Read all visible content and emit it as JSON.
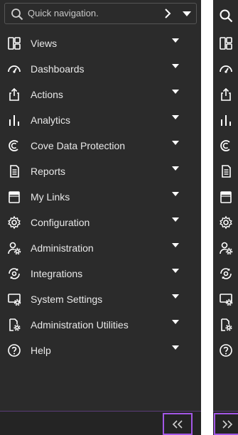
{
  "search": {
    "placeholder": "Quick navigation."
  },
  "nav": {
    "items": [
      {
        "label": "Views",
        "icon": "views-icon"
      },
      {
        "label": "Dashboards",
        "icon": "dashboards-icon"
      },
      {
        "label": "Actions",
        "icon": "actions-icon"
      },
      {
        "label": "Analytics",
        "icon": "analytics-icon"
      },
      {
        "label": "Cove Data Protection",
        "icon": "cove-icon"
      },
      {
        "label": "Reports",
        "icon": "reports-icon"
      },
      {
        "label": "My Links",
        "icon": "links-icon"
      },
      {
        "label": "Configuration",
        "icon": "configuration-icon"
      },
      {
        "label": "Administration",
        "icon": "administration-icon"
      },
      {
        "label": "Integrations",
        "icon": "integrations-icon"
      },
      {
        "label": "System Settings",
        "icon": "system-settings-icon"
      },
      {
        "label": "Administration Utilities",
        "icon": "admin-utilities-icon"
      },
      {
        "label": "Help",
        "icon": "help-icon"
      }
    ]
  },
  "colors": {
    "panel_bg": "#2b2b2b",
    "text": "#e9e9e9",
    "accent": "#a357e6"
  }
}
